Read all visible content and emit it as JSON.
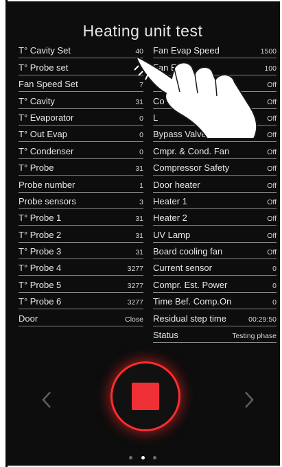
{
  "title": "Heating unit test",
  "left_rows": [
    {
      "label": "T° Cavity Set",
      "value": "40"
    },
    {
      "label": "T° Probe set",
      "value": ""
    },
    {
      "label": "Fan Speed Set",
      "value": "7"
    },
    {
      "label": "T° Cavity",
      "value": "31"
    },
    {
      "label": "T° Evaporator",
      "value": "0"
    },
    {
      "label": "T° Out Evap",
      "value": "0"
    },
    {
      "label": "T° Condenser",
      "value": "0"
    },
    {
      "label": "T° Probe",
      "value": "31"
    },
    {
      "label": "Probe number",
      "value": "1"
    },
    {
      "label": "Probe sensors",
      "value": "3"
    },
    {
      "label": "T° Probe 1",
      "value": "31"
    },
    {
      "label": "T° Probe 2",
      "value": "31"
    },
    {
      "label": "T° Probe 3",
      "value": "31"
    },
    {
      "label": "T° Probe 4",
      "value": "3277"
    },
    {
      "label": "T° Probe 5",
      "value": "3277"
    },
    {
      "label": "T° Probe 6",
      "value": "3277"
    },
    {
      "label": "Door",
      "value": "Close"
    }
  ],
  "right_rows": [
    {
      "label": "Fan Evap Speed",
      "value": "1500"
    },
    {
      "label": "Fan E",
      "value": "100"
    },
    {
      "label": "",
      "value": "Off"
    },
    {
      "label": "Co",
      "value": "Off"
    },
    {
      "label": "L",
      "value": "Off"
    },
    {
      "label": "Bypass Valve",
      "value": "Off"
    },
    {
      "label": "Cmpr. & Cond. Fan",
      "value": "Off"
    },
    {
      "label": "Compressor Safety",
      "value": "Off"
    },
    {
      "label": "Door heater",
      "value": "Off"
    },
    {
      "label": "Heater 1",
      "value": "Off"
    },
    {
      "label": "Heater 2",
      "value": "Off"
    },
    {
      "label": "UV Lamp",
      "value": "Off"
    },
    {
      "label": "Board cooling fan",
      "value": "Off"
    },
    {
      "label": "Current sensor",
      "value": "0"
    },
    {
      "label": "Compr. Est. Power",
      "value": "0"
    },
    {
      "label": "Time Bef. Comp.On",
      "value": "0"
    },
    {
      "label": "Residual step time",
      "value": "00:29:50"
    },
    {
      "label": "Status",
      "value": "Testing phase"
    }
  ],
  "icons": {
    "prev": "chevron-left-icon",
    "next": "chevron-right-icon",
    "stop": "stop-icon",
    "hand": "pointing-hand-icon"
  },
  "colors": {
    "background": "#0d0d0d",
    "accent_red": "#ef2f36",
    "glow": "#ff2d2d"
  },
  "pager": {
    "count": 3,
    "active": 1
  }
}
